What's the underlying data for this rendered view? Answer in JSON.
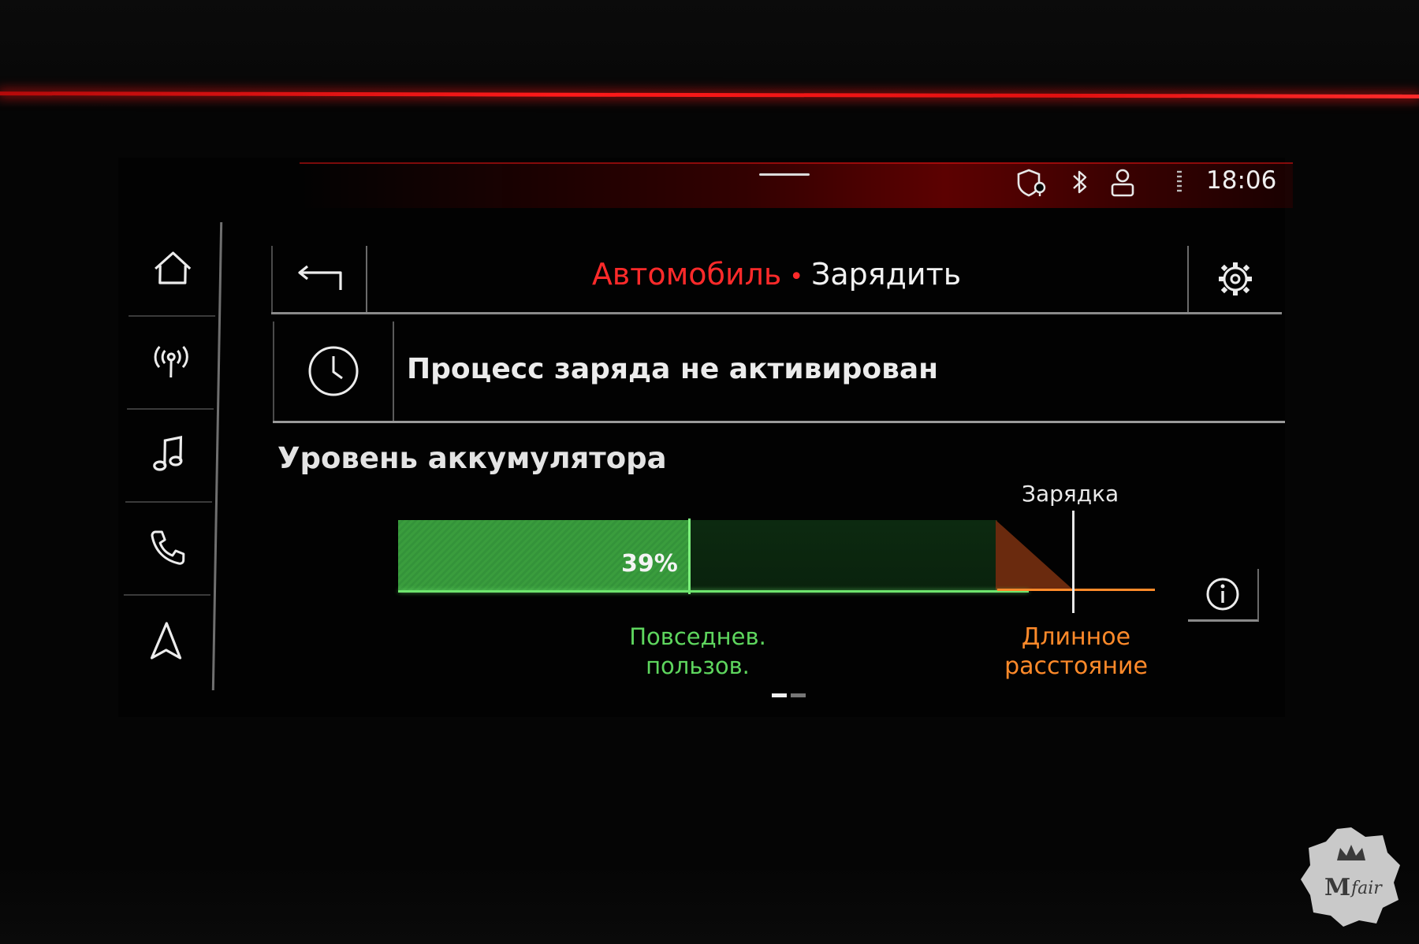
{
  "status_bar": {
    "time": "18:06",
    "icons": [
      "shield-location-icon",
      "bluetooth-icon",
      "user-icon",
      "signal-icon"
    ]
  },
  "sidebar": {
    "items": [
      {
        "name": "home",
        "icon": "home-icon"
      },
      {
        "name": "radio",
        "icon": "antenna-icon"
      },
      {
        "name": "media",
        "icon": "music-note-icon"
      },
      {
        "name": "phone",
        "icon": "phone-icon"
      },
      {
        "name": "navigation",
        "icon": "navigation-arrow-icon"
      }
    ]
  },
  "header": {
    "breadcrumb_parent": "Автомобиль",
    "separator": "•",
    "breadcrumb_current": "Зарядить",
    "back_icon": "back-arrow-icon",
    "settings_icon": "gear-icon"
  },
  "charge_status": {
    "icon": "clock-icon",
    "text": "Процесс заряда не активирован"
  },
  "battery": {
    "section_title": "Уровень аккумулятора",
    "level_percent": 39,
    "level_label": "39%",
    "charge_marker_label": "Зарядка",
    "everyday_label_line1": "Повседнев.",
    "everyday_label_line2": "пользов.",
    "long_distance_label_line1": "Длинное",
    "long_distance_label_line2": "расстояние",
    "info_icon": "info-icon"
  },
  "pagination": {
    "count": 2,
    "active_index": 0
  },
  "colors": {
    "accent_red": "#ff2a2a",
    "battery_green": "#3a9d3d",
    "everyday_green": "#5ed65e",
    "long_distance_orange": "#ff8a2a"
  },
  "watermark": {
    "text_1": "M",
    "text_2": "fair",
    "icon": "crown-icon"
  }
}
